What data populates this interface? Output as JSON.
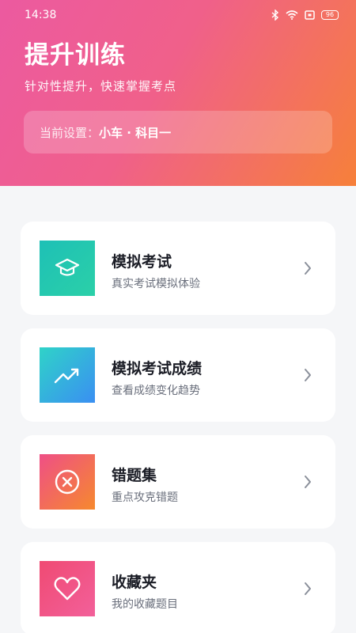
{
  "status_bar": {
    "time": "14:38",
    "battery": "96"
  },
  "header": {
    "title": "提升训练",
    "subtitle": "针对性提升，快速掌握考点",
    "settings_label": "当前设置：",
    "settings_value": "小车 · 科目一"
  },
  "cards": [
    {
      "title": "模拟考试",
      "subtitle": "真实考试模拟体验",
      "icon": "graduation-cap-icon"
    },
    {
      "title": "模拟考试成绩",
      "subtitle": "查看成绩变化趋势",
      "icon": "trend-up-icon"
    },
    {
      "title": "错题集",
      "subtitle": "重点攻克错题",
      "icon": "close-circle-icon"
    },
    {
      "title": "收藏夹",
      "subtitle": "我的收藏题目",
      "icon": "heart-icon"
    }
  ],
  "colors": {
    "header_gradient_start": "#ec5aa0",
    "header_gradient_end": "#f6803a",
    "background": "#f5f6f8"
  }
}
